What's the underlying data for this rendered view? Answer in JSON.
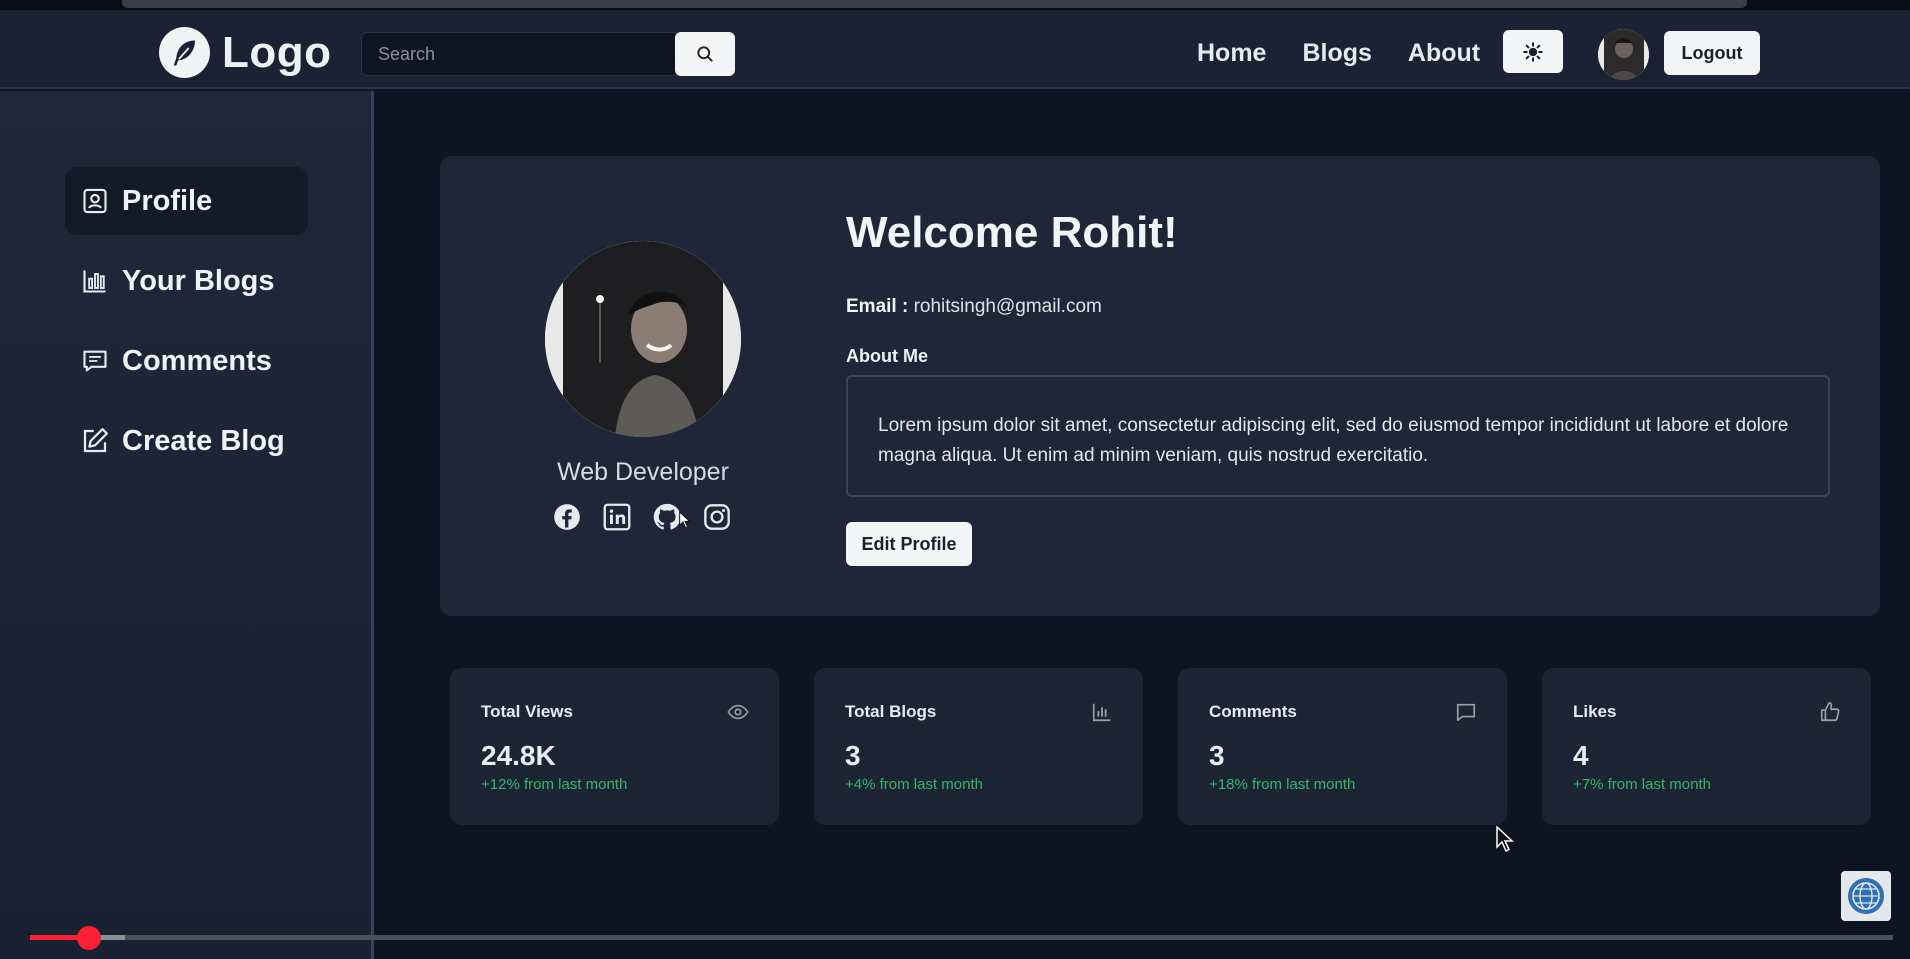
{
  "navbar": {
    "logo_text": "Logo",
    "search_placeholder": "Search",
    "links": [
      "Home",
      "Blogs",
      "About"
    ],
    "logout_label": "Logout"
  },
  "sidebar": {
    "items": [
      {
        "label": "Profile",
        "icon": "profile-icon",
        "active": true
      },
      {
        "label": "Your Blogs",
        "icon": "bar-chart-icon",
        "active": false
      },
      {
        "label": "Comments",
        "icon": "comment-icon",
        "active": false
      },
      {
        "label": "Create Blog",
        "icon": "edit-icon",
        "active": false
      }
    ]
  },
  "profile": {
    "welcome": "Welcome Rohit!",
    "email_label": "Email :",
    "email": "rohitsingh@gmail.com",
    "about_label": "About Me",
    "about_text": "Lorem ipsum dolor sit amet, consectetur adipiscing elit, sed do eiusmod tempor incididunt ut labore et dolore magna aliqua. Ut enim ad minim veniam, quis nostrud exercitatio.",
    "edit_label": "Edit Profile",
    "role": "Web Developer",
    "socials": [
      "facebook-icon",
      "linkedin-icon",
      "github-icon",
      "instagram-icon"
    ]
  },
  "stats": [
    {
      "title": "Total Views",
      "value": "24.8K",
      "delta": "+12% from last month",
      "icon": "eye-icon"
    },
    {
      "title": "Total Blogs",
      "value": "3",
      "delta": "+4% from last month",
      "icon": "bar-chart-icon"
    },
    {
      "title": "Comments",
      "value": "3",
      "delta": "+18% from last month",
      "icon": "comment-icon"
    },
    {
      "title": "Likes",
      "value": "4",
      "delta": "+7% from last month",
      "icon": "thumbs-up-icon"
    }
  ],
  "video": {
    "progress_fraction": 0.03
  },
  "colors": {
    "accent_green": "#36b56a",
    "progress_red": "#ff1f35",
    "card_bg": "#1e2637"
  }
}
